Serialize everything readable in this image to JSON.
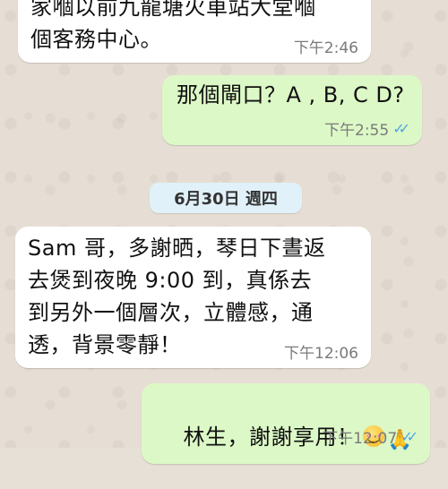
{
  "messages": [
    {
      "text": "家嗰以前九龍塘火車站大堂嗰\n個客務中心。",
      "time": "下午2:46"
    },
    {
      "text": "那個閘口？A , B, C D?",
      "time": "下午2:55",
      "ticks": "✓✓"
    },
    {
      "text": "Sam 哥，多謝晒，琴日下晝返\n去煲到夜晚 9:00 到，真係去\n到另外一個層次，立體感，通\n透，背景零靜！",
      "time": "下午12:06"
    },
    {
      "text": "林生，謝謝享用！",
      "time": "下午12:07",
      "ticks": "✓✓"
    }
  ],
  "date_divider": "6月30日 週四",
  "emoji": [
    "smiling-face",
    "folded-hands"
  ],
  "colors": {
    "incoming": "#ffffff",
    "outgoing": "#dcf8c6",
    "ticks": "#4fa6e6",
    "chip": "#e1f1f9"
  }
}
